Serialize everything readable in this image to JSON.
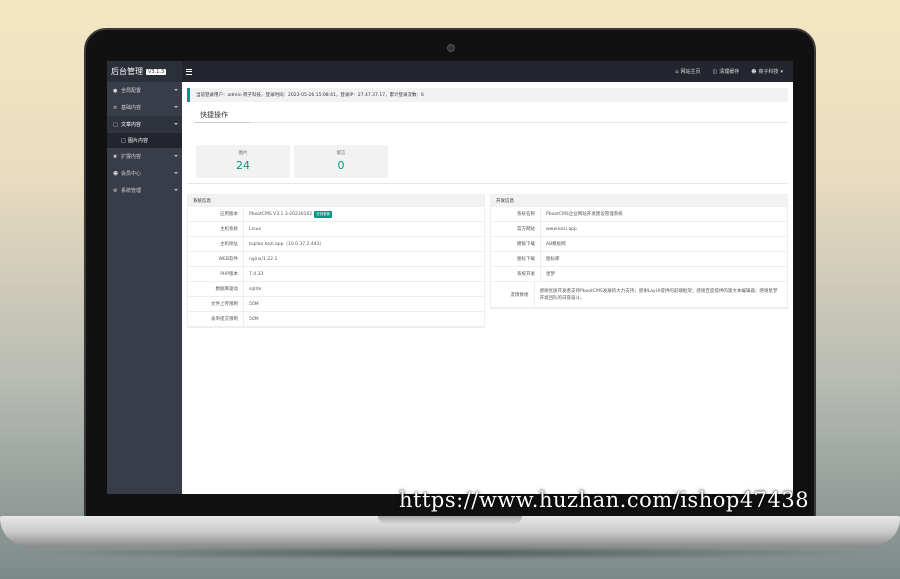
{
  "app": {
    "logo": "后台管理",
    "version": "V3.1.3"
  },
  "sidebar": {
    "items": [
      {
        "label": "全局配置",
        "icon": "globe-icon"
      },
      {
        "label": "基础内容",
        "icon": "list-icon"
      },
      {
        "label": "文章内容",
        "icon": "file-icon",
        "open": true
      },
      {
        "label": "扩展内容",
        "icon": "expand-icon"
      },
      {
        "label": "会员中心",
        "icon": "user-icon"
      },
      {
        "label": "系统管理",
        "icon": "gear-icon"
      }
    ],
    "sub_item": "图片内容"
  },
  "topbar": {
    "home": "网站主页",
    "clear_cache": "清理缓存",
    "user": "荷子科技"
  },
  "login_info": "当前登录用户：admin 荷子科技，登录时间：2023-05-26 15:08:41，登录IP：27.47.37.17，累计登录次数：6",
  "quick": {
    "title": "快捷操作",
    "stats": [
      {
        "label": "图片",
        "value": "24"
      },
      {
        "label": "留言",
        "value": "0"
      }
    ]
  },
  "system_panel": {
    "title": "系统信息",
    "rows": [
      {
        "key": "应用版本",
        "value": "PbootCMS V3.1.3-20230102",
        "badge": "在线更新"
      },
      {
        "key": "主机系统",
        "value": "Linux"
      },
      {
        "key": "主机地址",
        "value": "tuplan.kezi.app（10.0.37.2:443）"
      },
      {
        "key": "WEB软件",
        "value": "nginx/1.22.1"
      },
      {
        "key": "PHP版本",
        "value": "7.4.33"
      },
      {
        "key": "数据库驱动",
        "value": "sqlite"
      },
      {
        "key": "文件上传限制",
        "value": "50M"
      },
      {
        "key": "表单提交限制",
        "value": "50M"
      }
    ]
  },
  "dev_panel": {
    "title": "开发信息",
    "rows": [
      {
        "key": "系统名称",
        "value": "PbootCMS企业网站开发建设管理系统"
      },
      {
        "key": "官方网站",
        "value": "www.kezi.app"
      },
      {
        "key": "模板下载",
        "value": "AB模板网"
      },
      {
        "key": "图标下载",
        "value": "图标库"
      },
      {
        "key": "系统开发",
        "value": "星梦"
      },
      {
        "key": "友情致谢",
        "value": "感谢优质开发者支持PbootCMS发展的大力支持；感谢LayUI提供的前端框架；感谢百度提供的富文本编辑器；感谢星梦开发团队的日夜奋斗。"
      }
    ]
  },
  "watermark": "https://www.huzhan.com/ishop47438",
  "colors": {
    "accent": "#009688",
    "sidebar": "#393d49",
    "topbar": "#23262e"
  }
}
